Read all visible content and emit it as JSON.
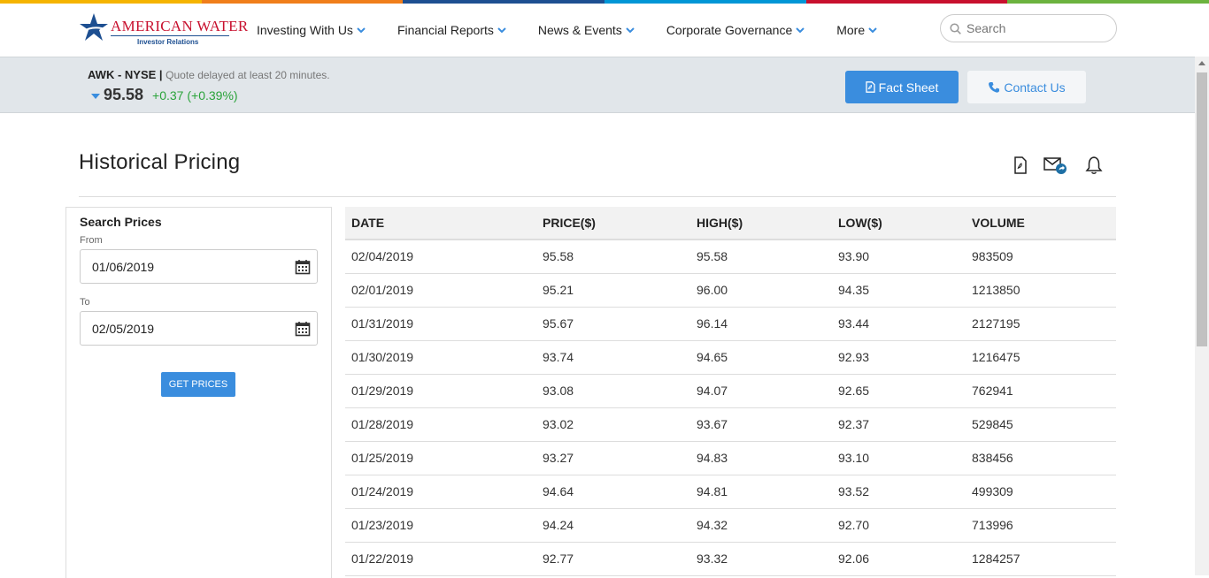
{
  "colors": {
    "stripe": [
      "#f5b400",
      "#f07e1b",
      "#1d4f91",
      "#0096d6",
      "#c8102e",
      "#6cb33f"
    ],
    "accent": "#3a8dde",
    "positive": "#2aa33a",
    "brand_red": "#c8102e",
    "brand_blue": "#1d4f91"
  },
  "logo": {
    "name": "AMERICAN WATER",
    "sub": "Investor Relations"
  },
  "nav": [
    {
      "label": "Investing With Us"
    },
    {
      "label": "Financial Reports"
    },
    {
      "label": "News & Events"
    },
    {
      "label": "Corporate Governance"
    },
    {
      "label": "More"
    }
  ],
  "search": {
    "placeholder": "Search",
    "icon": "search-icon"
  },
  "quote": {
    "ticker": "AWK - NYSE",
    "separator": " | ",
    "delay_note": "Quote delayed at least 20 minutes.",
    "direction_icon": "caret-down-icon",
    "price": "95.58",
    "change": "+0.37 (+0.39%)"
  },
  "buttons": {
    "fact_sheet": "Fact Sheet",
    "contact_us": "Contact Us"
  },
  "page": {
    "title": "Historical Pricing",
    "tools": [
      "pdf-icon",
      "email-share-icon",
      "bell-icon"
    ]
  },
  "search_panel": {
    "title": "Search Prices",
    "from_label": "From",
    "from_value": "01/06/2019",
    "to_label": "To",
    "to_value": "02/05/2019",
    "button": "GET PRICES"
  },
  "table": {
    "headers": [
      "DATE",
      "PRICE($)",
      "HIGH($)",
      "LOW($)",
      "VOLUME"
    ],
    "rows": [
      [
        "02/04/2019",
        "95.58",
        "95.58",
        "93.90",
        "983509"
      ],
      [
        "02/01/2019",
        "95.21",
        "96.00",
        "94.35",
        "1213850"
      ],
      [
        "01/31/2019",
        "95.67",
        "96.14",
        "93.44",
        "2127195"
      ],
      [
        "01/30/2019",
        "93.74",
        "94.65",
        "92.93",
        "1216475"
      ],
      [
        "01/29/2019",
        "93.08",
        "94.07",
        "92.65",
        "762941"
      ],
      [
        "01/28/2019",
        "93.02",
        "93.67",
        "92.37",
        "529845"
      ],
      [
        "01/25/2019",
        "93.27",
        "94.83",
        "93.10",
        "838456"
      ],
      [
        "01/24/2019",
        "94.64",
        "94.81",
        "93.52",
        "499309"
      ],
      [
        "01/23/2019",
        "94.24",
        "94.32",
        "92.70",
        "713996"
      ],
      [
        "01/22/2019",
        "92.77",
        "93.32",
        "92.06",
        "1284257"
      ]
    ]
  }
}
